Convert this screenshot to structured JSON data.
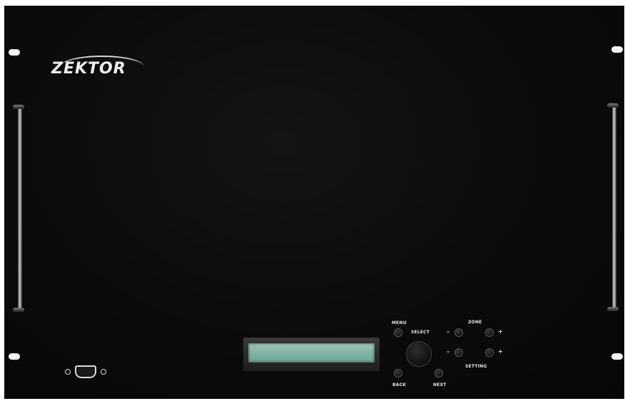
{
  "brand": {
    "logo_text": "ZEKTOR"
  },
  "display": {
    "text": ""
  },
  "controls": {
    "menu_label": "MENU",
    "select_label": "SELECT",
    "back_label": "BACK",
    "next_label": "NEXT",
    "zone_label": "ZONE",
    "setting_label": "SETTING",
    "minus_symbol": "–",
    "plus_symbol": "+"
  },
  "colors": {
    "panel": "#0b0b0b",
    "lcd_backlight": "#8fbcae",
    "labels": "#e6e6e6"
  },
  "icons": [
    "rack-slot-icon",
    "handle-icon",
    "serial-port-icon",
    "select-knob-icon"
  ]
}
